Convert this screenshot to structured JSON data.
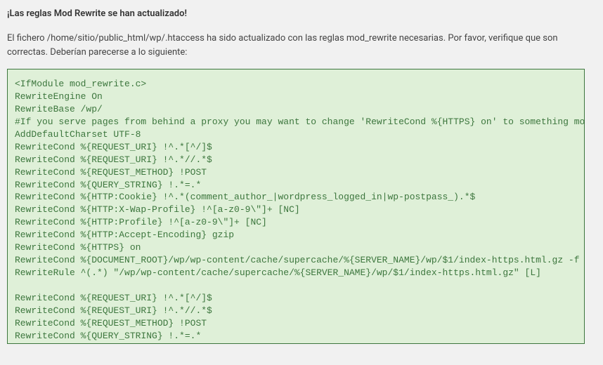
{
  "title": "¡Las reglas Mod Rewrite se han actualizado!",
  "description": "El fichero /home/sitio/public_html/wp/.htaccess ha sido actualizado con las reglas mod_rewrite necesarias. Por favor, verifique que son correctas. Deberían parecerse a lo siguiente:",
  "code": "<IfModule mod_rewrite.c>\nRewriteEngine On\nRewriteBase /wp/\n#If you serve pages from behind a proxy you may want to change 'RewriteCond %{HTTPS} on' to something more sensible\nAddDefaultCharset UTF-8\nRewriteCond %{REQUEST_URI} !^.*[^/]$\nRewriteCond %{REQUEST_URI} !^.*//.*$\nRewriteCond %{REQUEST_METHOD} !POST\nRewriteCond %{QUERY_STRING} !.*=.*\nRewriteCond %{HTTP:Cookie} !^.*(comment_author_|wordpress_logged_in|wp-postpass_).*$\nRewriteCond %{HTTP:X-Wap-Profile} !^[a-z0-9\\\"]+ [NC]\nRewriteCond %{HTTP:Profile} !^[a-z0-9\\\"]+ [NC]\nRewriteCond %{HTTP:Accept-Encoding} gzip\nRewriteCond %{HTTPS} on\nRewriteCond %{DOCUMENT_ROOT}/wp/wp-content/cache/supercache/%{SERVER_NAME}/wp/$1/index-https.html.gz -f\nRewriteRule ^(.*) \"/wp/wp-content/cache/supercache/%{SERVER_NAME}/wp/$1/index-https.html.gz\" [L]\n\nRewriteCond %{REQUEST_URI} !^.*[^/]$\nRewriteCond %{REQUEST_URI} !^.*//.*$\nRewriteCond %{REQUEST_METHOD} !POST\nRewriteCond %{QUERY_STRING} !.*=.*"
}
